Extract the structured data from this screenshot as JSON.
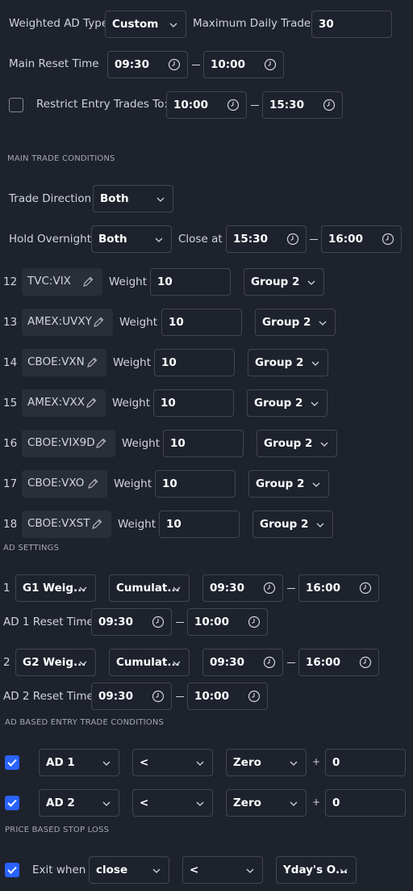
{
  "top": {
    "weighted_ad_type_label": "Weighted AD Type",
    "weighted_ad_type_value": "Custom",
    "max_daily_trades_label": "Maximum Daily Trades",
    "max_daily_trades_value": "30",
    "main_reset_label": "Main Reset Time",
    "main_reset_start": "09:30",
    "main_reset_end": "10:00",
    "restrict_label": "Restrict Entry Trades To:",
    "restrict_checked": false,
    "restrict_start": "10:00",
    "restrict_end": "15:30"
  },
  "main_section_title": "MAIN TRADE CONDITIONS",
  "main": {
    "trade_direction_label": "Trade Direction",
    "trade_direction_value": "Both",
    "hold_overnight_label": "Hold Overnight",
    "hold_overnight_value": "Both",
    "close_at_label": "Close at",
    "close_at_start": "15:30",
    "close_at_end": "16:00"
  },
  "symbols_weight_label": "Weight",
  "symbols": [
    {
      "num": "12",
      "symbol": "TVC:VIX",
      "weight": "10",
      "group": "Group 2"
    },
    {
      "num": "13",
      "symbol": "AMEX:UVXY",
      "weight": "10",
      "group": "Group 2"
    },
    {
      "num": "14",
      "symbol": "CBOE:VXN",
      "weight": "10",
      "group": "Group 2"
    },
    {
      "num": "15",
      "symbol": "AMEX:VXX",
      "weight": "10",
      "group": "Group 2"
    },
    {
      "num": "16",
      "symbol": "CBOE:VIX9D",
      "weight": "10",
      "group": "Group 2"
    },
    {
      "num": "17",
      "symbol": "CBOE:VXO",
      "weight": "10",
      "group": "Group 2"
    },
    {
      "num": "18",
      "symbol": "CBOE:VXST",
      "weight": "10",
      "group": "Group 2"
    }
  ],
  "ad_section_title": "AD SETTINGS",
  "ad": [
    {
      "num": "1",
      "source": "G1 Weig...",
      "mode": "Cumulat...",
      "start": "09:30",
      "end": "16:00",
      "reset_label": "AD 1 Reset Time",
      "reset_start": "09:30",
      "reset_end": "10:00"
    },
    {
      "num": "2",
      "source": "G2 Weig...",
      "mode": "Cumulat...",
      "start": "09:30",
      "end": "16:00",
      "reset_label": "AD 2 Reset Time",
      "reset_start": "09:30",
      "reset_end": "10:00"
    }
  ],
  "ad_entry_section_title": "AD BASED ENTRY TRADE CONDITIONS",
  "ad_entry": [
    {
      "checked": true,
      "line": "AD 1",
      "op": "<",
      "ref": "Zero",
      "plus": "+",
      "offset": "0"
    },
    {
      "checked": true,
      "line": "AD 2",
      "op": "<",
      "ref": "Zero",
      "plus": "+",
      "offset": "0"
    }
  ],
  "stop_section_title": "PRICE BASED STOP LOSS",
  "stop": {
    "checked": true,
    "label": "Exit when",
    "source": "close",
    "op": "<",
    "ref": "Yday's O..."
  },
  "colors": {
    "background": "#1e222d",
    "border": "#434651",
    "accent": "#2962ff",
    "chip": "#2a2e39"
  },
  "icons": [
    "clock-icon",
    "chevron-down-icon",
    "pencil-icon",
    "checkmark-icon"
  ]
}
